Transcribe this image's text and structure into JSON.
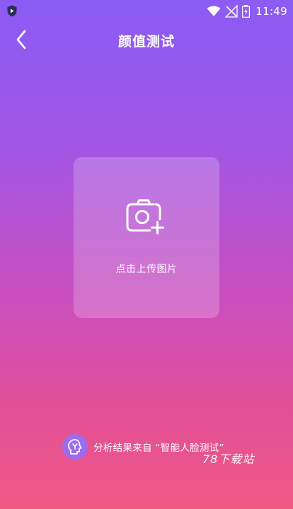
{
  "status_bar": {
    "time": "11:49",
    "icons": [
      "shield-icon",
      "wifi-icon",
      "no-signal-icon",
      "battery-icon"
    ]
  },
  "header": {
    "back_icon": "chevron-left-icon",
    "title": "颜值测试"
  },
  "upload": {
    "icon": "camera-plus-icon",
    "label": "点击上传图片"
  },
  "footer": {
    "icon": "ai-brain-icon",
    "text": "分析结果来自 “智能人脸测试”"
  },
  "watermark": {
    "text": "78下载站"
  },
  "colors": {
    "gradient_top": "#8b5cf4",
    "gradient_bottom": "#ee5a84",
    "badge": "#9c6bf0"
  }
}
